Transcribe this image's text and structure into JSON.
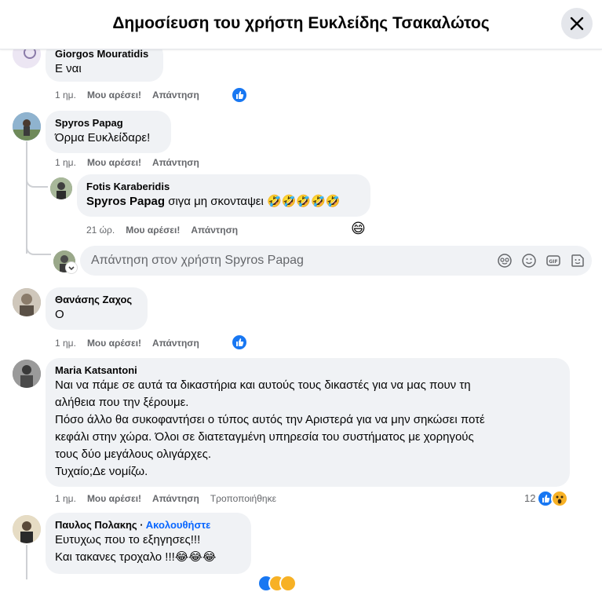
{
  "header": {
    "title": "Δημοσίευση του χρήστη Ευκλείδης Τσακαλώτος"
  },
  "common": {
    "like_label": "Μου αρέσει!",
    "reply_label": "Απάντηση",
    "edited_label": "Τροποποιήθηκε"
  },
  "comments": [
    {
      "author": "Giorgos Mouratidis",
      "text": "Ε ναι",
      "time": "1 ημ."
    },
    {
      "author": "Spyros Papag",
      "text": "Όρμα Ευκλείδαρε!",
      "time": "1 ημ."
    },
    {
      "author": "Θανάσης Ζαχος",
      "text": "Ο",
      "time": "1 ημ."
    },
    {
      "author": "Maria Katsantoni",
      "lines": [
        "Ναι να πάμε σε αυτά τα δικαστήρια και αυτούς τους δικαστές για να μας πουν τη",
        "αλήθεια που την ξέρουμε.",
        "Πόσο άλλο θα συκοφαντήσει ο τύπος αυτός την Αριστερά για να μην σηκώσει ποτέ",
        "κεφάλι στην χώρα. Όλοι σε διατεταγμένη υπηρεσία του συστήματος με χορηγούς",
        "τους δύο μεγάλους ολιγάρχες.",
        "Τυχαίο;Δε νομίζω."
      ],
      "time": "1 ημ.",
      "reaction_count": "12"
    },
    {
      "author": "Παυλος Πολακης",
      "follow_label": "Ακολουθήστε",
      "lines": [
        "Ευτυχως που το εξηγησες!!!",
        "Και τακανες τροχαλο !!!😂😂😂"
      ]
    }
  ],
  "reply": {
    "author": "Fotis Karaberidis",
    "mention": "Spyros Papag",
    "text": " σιγα μη σκονταψει 🤣🤣🤣🤣🤣",
    "time": "21 ώρ.",
    "reaction_emoji": "😄"
  },
  "reply_box": {
    "placeholder": "Απάντηση στον χρήστη Spyros Papag"
  }
}
